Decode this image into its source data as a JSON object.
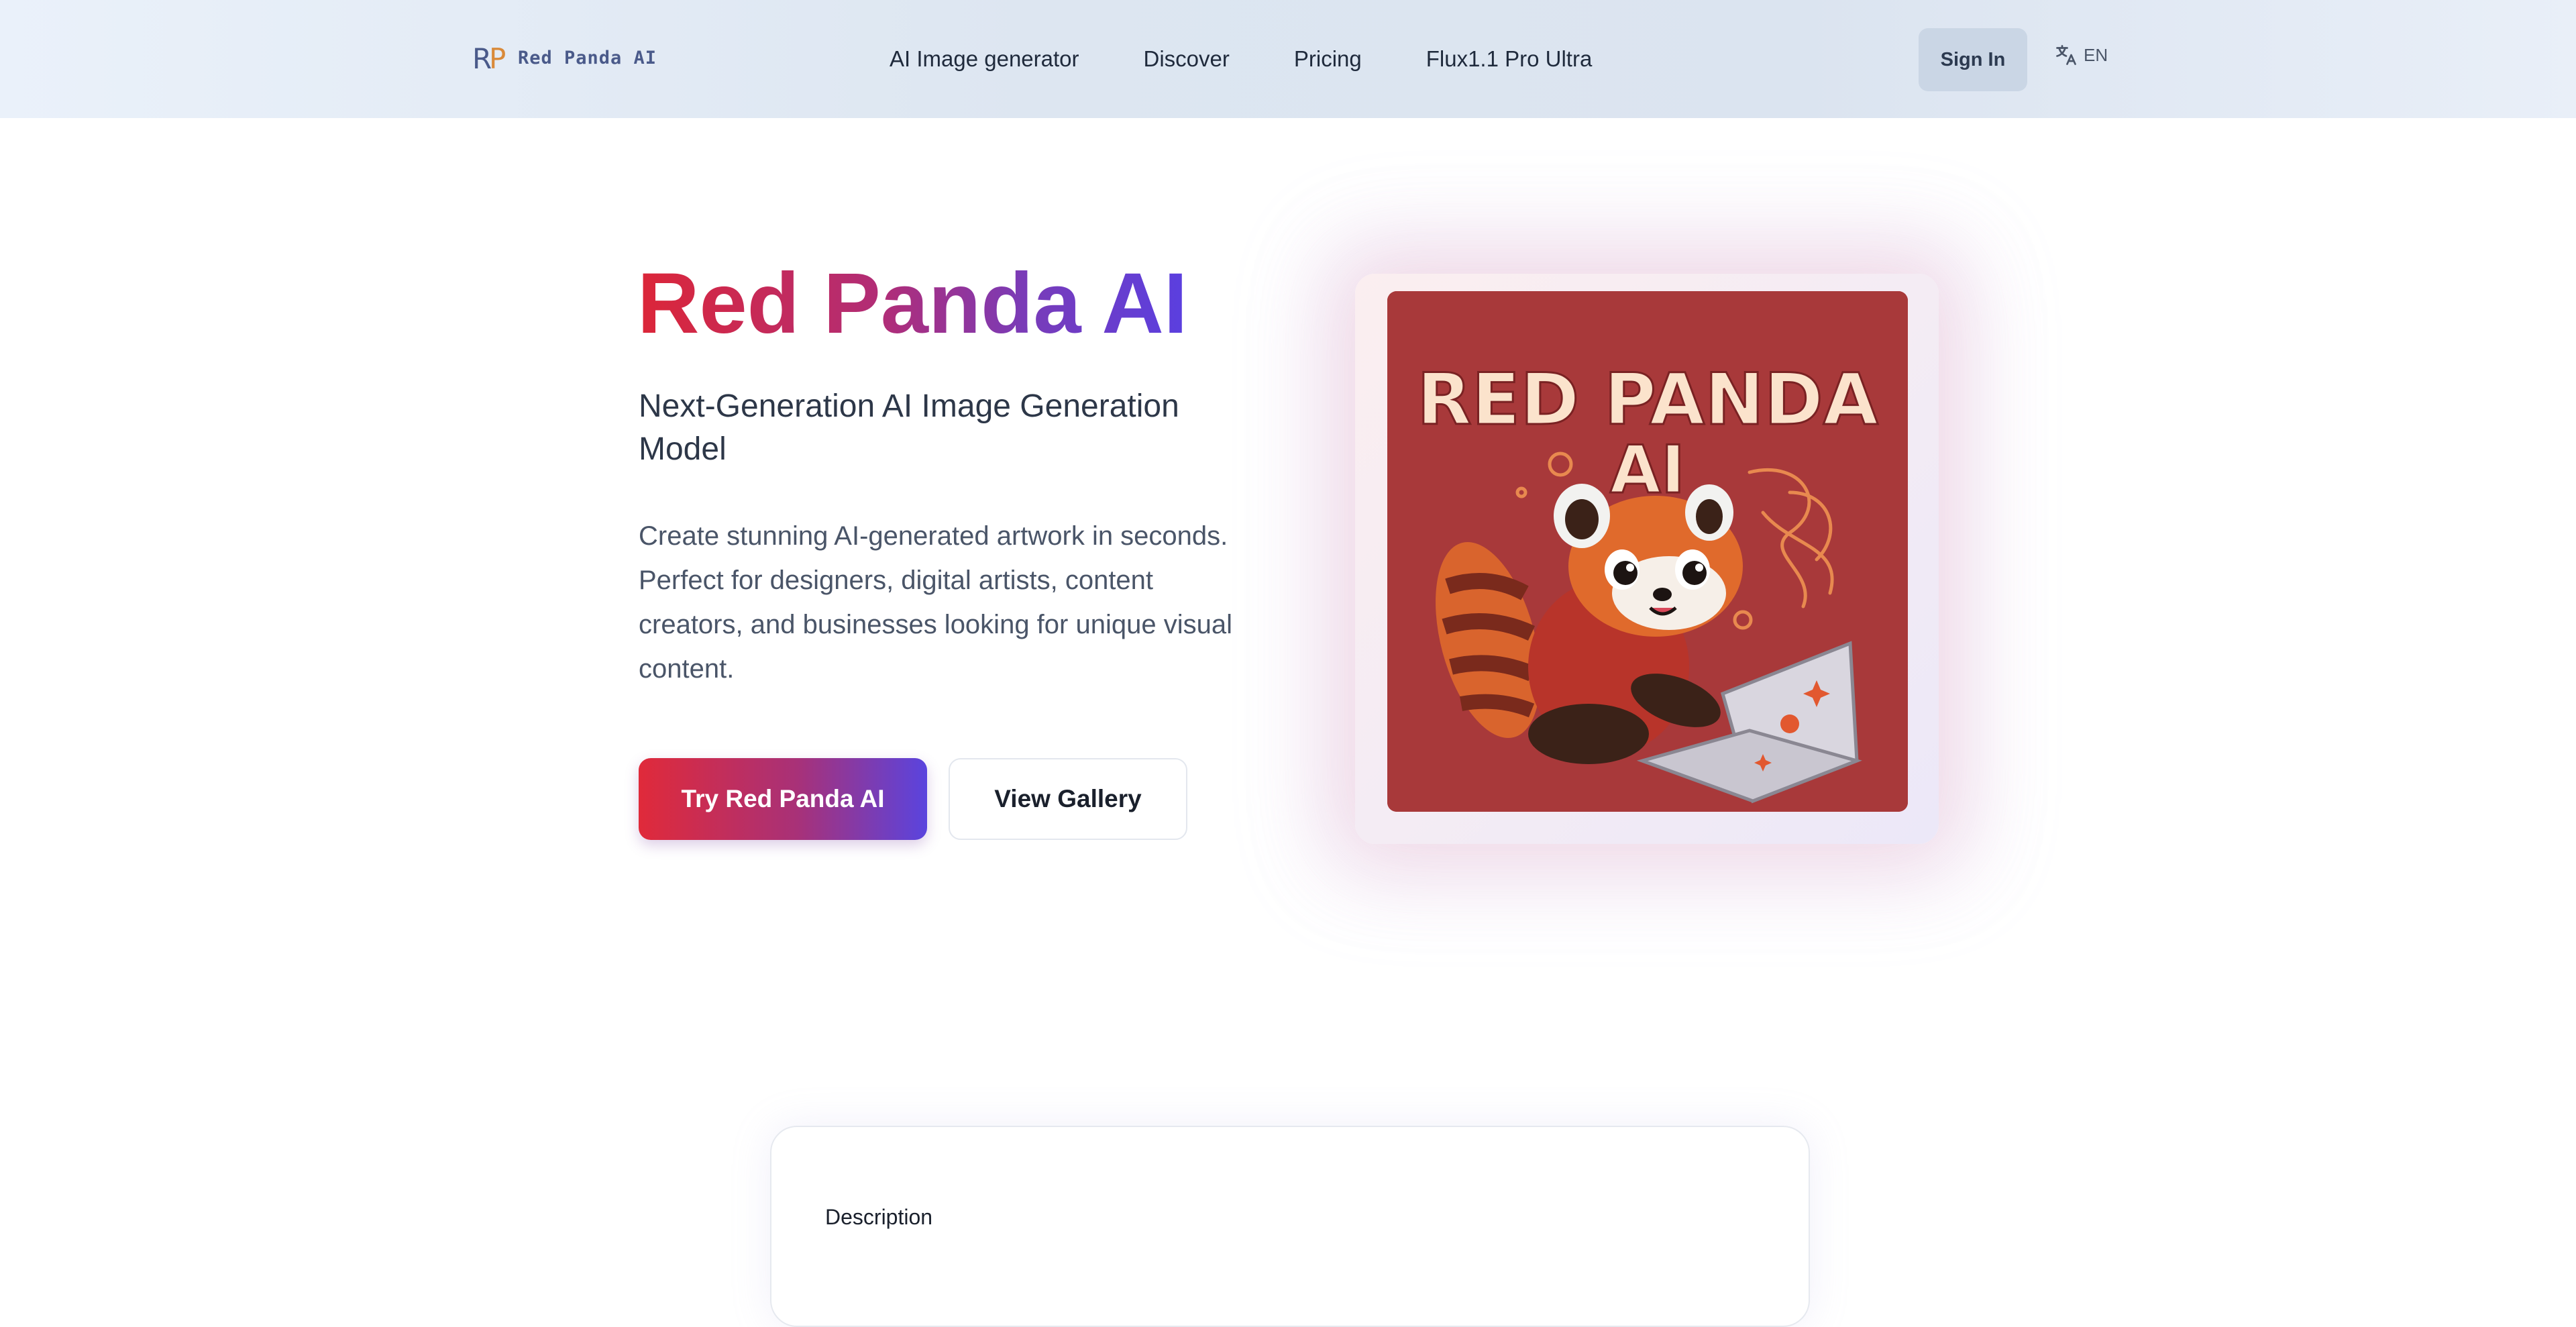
{
  "nav": {
    "logo_text": "Red Panda AI",
    "links": [
      "AI Image generator",
      "Discover",
      "Pricing",
      "Flux1.1 Pro Ultra"
    ],
    "signin_label": "Sign In",
    "lang_label": "EN",
    "lang_icon": "translate-icon"
  },
  "hero": {
    "title": "Red Panda AI",
    "subtitle": "Next-Generation AI Image Generation Model",
    "description": "Create stunning AI-generated artwork in seconds. Perfect for designers, digital artists, content creators, and businesses looking for unique visual content.",
    "primary_button": "Try Red Panda AI",
    "secondary_button": "View Gallery",
    "image_text": "RED PANDA AI"
  },
  "description_section": {
    "label": "Description"
  },
  "colors": {
    "brand_red": "#dc2638",
    "brand_purple": "#5a3fe0",
    "nav_bg": "#dde6f1",
    "art_bg": "#a8393a"
  }
}
